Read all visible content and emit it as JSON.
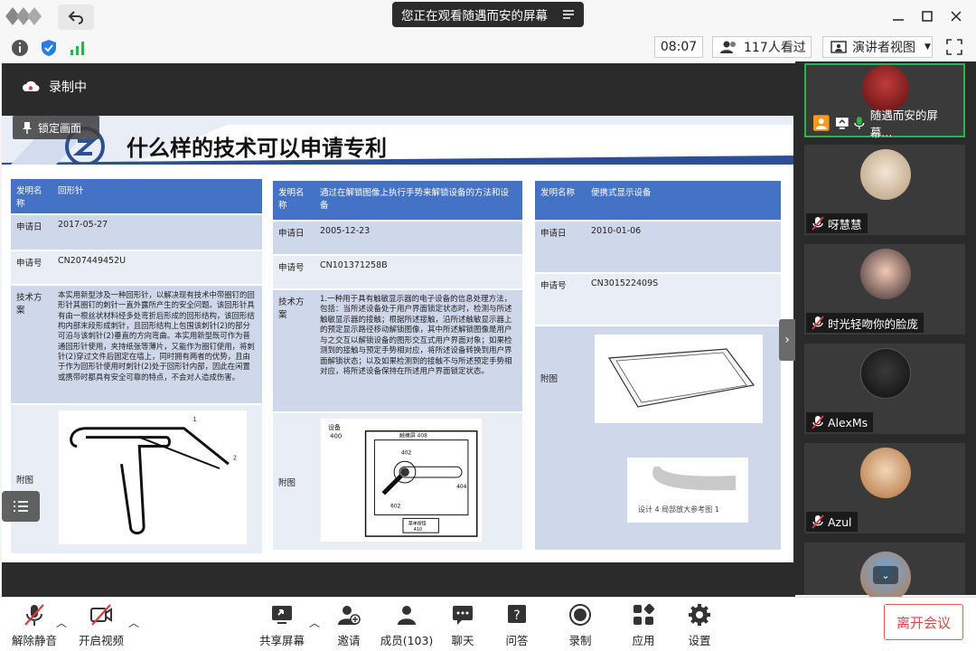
{
  "titlebar": {
    "share_text": "您正在观看随遇而安的屏幕"
  },
  "status": {
    "time": "08:07",
    "viewers": "117人看过",
    "view_mode": "演讲者视图"
  },
  "main": {
    "recording": "录制中",
    "lock": "锁定画面"
  },
  "slide": {
    "title": "什么样的技术可以申请专利",
    "tables": [
      {
        "rows": [
          {
            "k": "发明名称",
            "v": "回形针"
          },
          {
            "k": "申请日",
            "v": "2017-05-27"
          },
          {
            "k": "申请号",
            "v": "CN207449452U"
          },
          {
            "k": "技术方案",
            "v": "本实用新型涉及一种回形针，以解决现有技术中带圈钉的回形针其圈钉的刺针一直外露所产生的安全问题。该回形针具有由一根丝状材料经多处弯折后形成的回形结构，该回形结构内部末段形成刺针，且回形结构上包围该刺针(2)的部分可沿与该刺针(2)垂直的方向弯曲。本实用新型既可作为普通回形针使用，夹持纸张等薄片，又能作为圈钉使用，将刺针(2)穿过文件后固定在墙上，同时拥有两者的优势，且由于作为回形针使用时刺针(2)处于回形针内部，因此在闲置或携带时都具有安全可靠的特点，不会对人造成伤害。"
          },
          {
            "k": "附图",
            "v": ""
          }
        ]
      },
      {
        "rows": [
          {
            "k": "发明名称",
            "v": "通过在解锁图像上执行手势来解锁设备的方法和设备"
          },
          {
            "k": "申请日",
            "v": "2005-12-23"
          },
          {
            "k": "申请号",
            "v": "CN101371258B"
          },
          {
            "k": "技术方案",
            "v": "1.一种用于具有触敏显示器的电子设备的信息处理方法，包括：当所述设备处于用户界面锁定状态时，检测与所述触敏显示器的接触；根据所述接触，沿所述触敏显示器上的预定显示路径移动解锁图像，其中所述解锁图像是用户与之交互以解锁设备的图形交互式用户界面对象；如果检测到的接触与预定手势相对应，将所述设备转换到用户界面解锁状态；以及如果检测到的接触不与所述预定手势相对应，将所述设备保持在所述用户界面锁定状态。"
          },
          {
            "k": "附图",
            "v": ""
          }
        ],
        "figure_labels": {
          "device": "设备",
          "device_num": "400",
          "top": "触摸屏 408",
          "n402": "402",
          "n404": "404",
          "n602": "602",
          "bottom1": "菜单按钮",
          "bottom2": "410"
        }
      },
      {
        "rows": [
          {
            "k": "发明名称",
            "v": "便携式显示设备"
          },
          {
            "k": "申请日",
            "v": "2010-01-06"
          },
          {
            "k": "申请号",
            "v": "CN301522409S"
          },
          {
            "k": "附图",
            "v": ""
          }
        ],
        "figure_caption": "设计 4 局部放大参考图 1"
      }
    ]
  },
  "participants": [
    {
      "name": "随遇而安的屏幕...",
      "active": true
    },
    {
      "name": "呀慧慧"
    },
    {
      "name": "时光轻吻你的脸庞"
    },
    {
      "name": "AlexMs"
    },
    {
      "name": "Azul"
    }
  ],
  "bottom": {
    "unmute": "解除静音",
    "video": "开启视频",
    "share": "共享屏幕",
    "invite": "邀请",
    "members": "成员(103)",
    "chat": "聊天",
    "qa": "问答",
    "record": "录制",
    "apps": "应用",
    "settings": "设置",
    "leave": "离开会议"
  },
  "colors": {
    "header_blue": "#4472c4",
    "row_a": "#cfd7ea",
    "row_b": "#e9edf5",
    "leave_red": "#e04545"
  }
}
